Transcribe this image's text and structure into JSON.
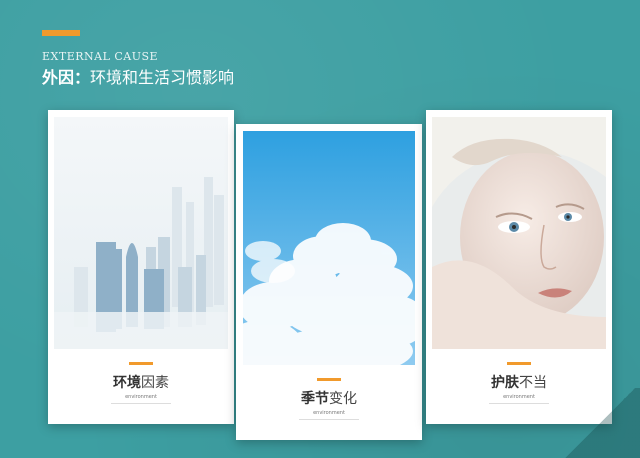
{
  "header": {
    "subtitle_en": "EXTERNAL CAUSE",
    "title_bold": "外因：",
    "title_rest": "环境和生活习惯影响"
  },
  "cards": [
    {
      "title_bold": "环境",
      "title_rest": "因素",
      "subtitle": "environment"
    },
    {
      "title_bold": "季节",
      "title_rest": "变化",
      "subtitle": "environment"
    },
    {
      "title_bold": "护肤",
      "title_rest": "不当",
      "subtitle": "environment"
    }
  ],
  "colors": {
    "background": "#3d9fa2",
    "accent": "#f19a2c",
    "card": "#ffffff"
  }
}
